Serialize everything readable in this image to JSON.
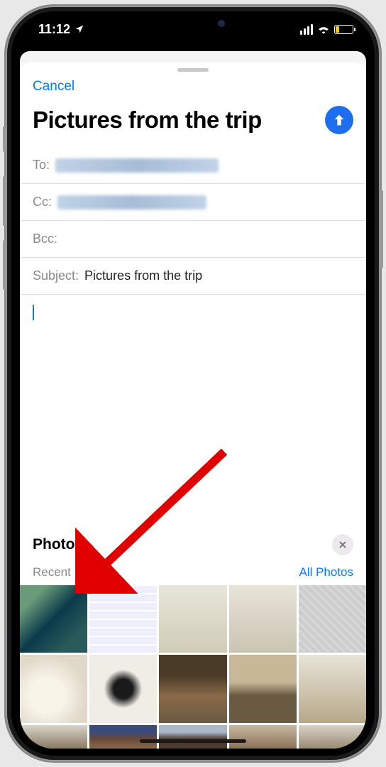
{
  "status": {
    "time": "11:12"
  },
  "nav": {
    "cancel": "Cancel"
  },
  "title": "Pictures from the trip",
  "fields": {
    "to_label": "To:",
    "cc_label": "Cc:",
    "bcc_label": "Bcc:",
    "subject_label": "Subject:",
    "subject_value": "Pictures from the trip"
  },
  "photos": {
    "header": "Photos",
    "recent_label": "Recent Photos",
    "all_link": "All Photos"
  }
}
